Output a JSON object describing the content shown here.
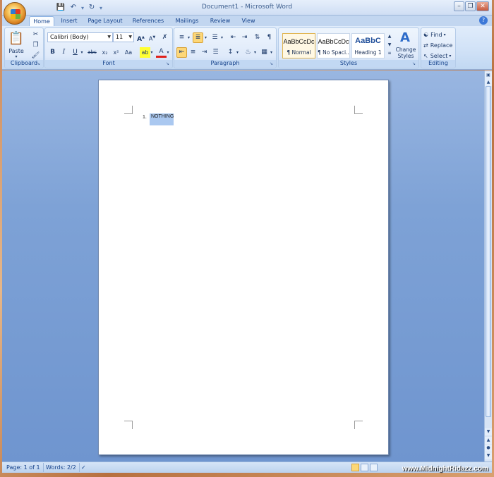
{
  "window": {
    "title": "Document1 - Microsoft Word"
  },
  "qat": {
    "undo_sep": "·",
    "dropdown": "▾"
  },
  "tabs": [
    {
      "label": "Home",
      "active": true
    },
    {
      "label": "Insert"
    },
    {
      "label": "Page Layout"
    },
    {
      "label": "References"
    },
    {
      "label": "Mailings"
    },
    {
      "label": "Review"
    },
    {
      "label": "View"
    }
  ],
  "ribbon": {
    "clipboard": {
      "label": "Clipboard",
      "paste_label": "Paste"
    },
    "font": {
      "label": "Font",
      "font_name": "Calibri (Body)",
      "font_size": "11",
      "bold": "B",
      "italic": "I",
      "underline": "U",
      "strike": "abc",
      "subscript": "x₂",
      "superscript": "x²",
      "case": "Aa"
    },
    "paragraph": {
      "label": "Paragraph"
    },
    "styles": {
      "label": "Styles",
      "items": [
        {
          "sample": "AaBbCcDc",
          "name": "¶ Normal",
          "selected": true
        },
        {
          "sample": "AaBbCcDc",
          "name": "¶ No Spaci..."
        },
        {
          "sample": "AaBbC",
          "name": "Heading 1"
        }
      ],
      "change_styles": "Change Styles"
    },
    "editing": {
      "label": "Editing",
      "find": "Find",
      "replace": "Replace",
      "select": "Select"
    }
  },
  "document": {
    "list_number": "1.",
    "list_text": "NOTHING"
  },
  "status": {
    "page": "Page: 1 of 1",
    "words": "Words: 2/2"
  },
  "watermark": "www.MidnightRidazz.com",
  "colors": {
    "accent": "#15428b",
    "ribbon": "#d1e2f7",
    "highlight": "#fdd778",
    "text_color_red": "#e0211b",
    "highlight_yellow": "#ffff33"
  }
}
